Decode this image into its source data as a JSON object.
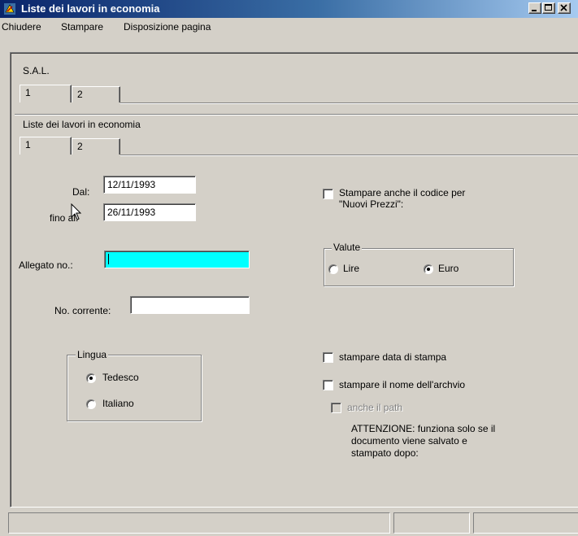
{
  "window": {
    "title": "Liste dei lavori in economia",
    "icon": "app-icon"
  },
  "menu": {
    "items": [
      "Chiudere",
      "Stampare",
      "Disposizione pagina"
    ]
  },
  "outer_section": {
    "label": "S.A.L.",
    "tabs": [
      "1",
      "2"
    ]
  },
  "inner_section": {
    "label": "Liste dei lavori in economia",
    "tabs": [
      "1",
      "2"
    ]
  },
  "form": {
    "dal_label": "Dal:",
    "dal_value": "12/11/1993",
    "fino_label": "fino al:",
    "fino_value": "26/11/1993",
    "allegato_label": "Allegato no.:",
    "allegato_value": "",
    "corrente_label": "No. corrente:",
    "corrente_value": "",
    "lingua": {
      "legend": "Lingua",
      "options": [
        "Tedesco",
        "Italiano"
      ],
      "selected": "Tedesco"
    },
    "codice_check": {
      "line1": "Stampare anche il codice per",
      "line2": "\"Nuovi Prezzi\":",
      "checked": false
    },
    "valute": {
      "legend": "Valute",
      "options": [
        "Lire",
        "Euro"
      ],
      "selected": "Euro"
    },
    "data_stampa_check": {
      "label": "stampare data di stampa",
      "checked": false
    },
    "nome_archivio_check": {
      "label": "stampare il nome dell'archvio",
      "checked": false
    },
    "path_check": {
      "label": "anche il path",
      "checked": false,
      "enabled": false
    },
    "attenzione": {
      "line1": "ATTENZIONE: funziona solo se il",
      "line2": "documento viene salvato e",
      "line3": "stampato dopo:"
    }
  },
  "colors": {
    "face": "#d4d0c8",
    "title_start": "#0a246a",
    "title_end": "#a6caf0",
    "highlight_field": "#00ffff"
  }
}
